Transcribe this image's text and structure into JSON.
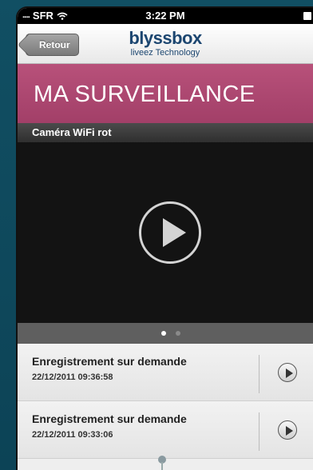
{
  "status": {
    "carrier": "SFR",
    "signal_dots": ".....",
    "time": "3:22 PM"
  },
  "nav": {
    "back_label": "Retour",
    "logo_brand": "blyssbox",
    "logo_tagline": "liveez Technology"
  },
  "page": {
    "title": "MA SURVEILLANCE"
  },
  "camera": {
    "name": "Caméra WiFi rot"
  },
  "pager": {
    "count": 2,
    "active": 0
  },
  "recordings": [
    {
      "title": "Enregistrement sur demande",
      "datetime": "22/12/2011 09:36:58"
    },
    {
      "title": "Enregistrement sur demande",
      "datetime": "22/12/2011 09:33:06"
    }
  ],
  "colors": {
    "accent": "#a8446d",
    "brand": "#1c4670",
    "background": "#0e4a5e"
  }
}
